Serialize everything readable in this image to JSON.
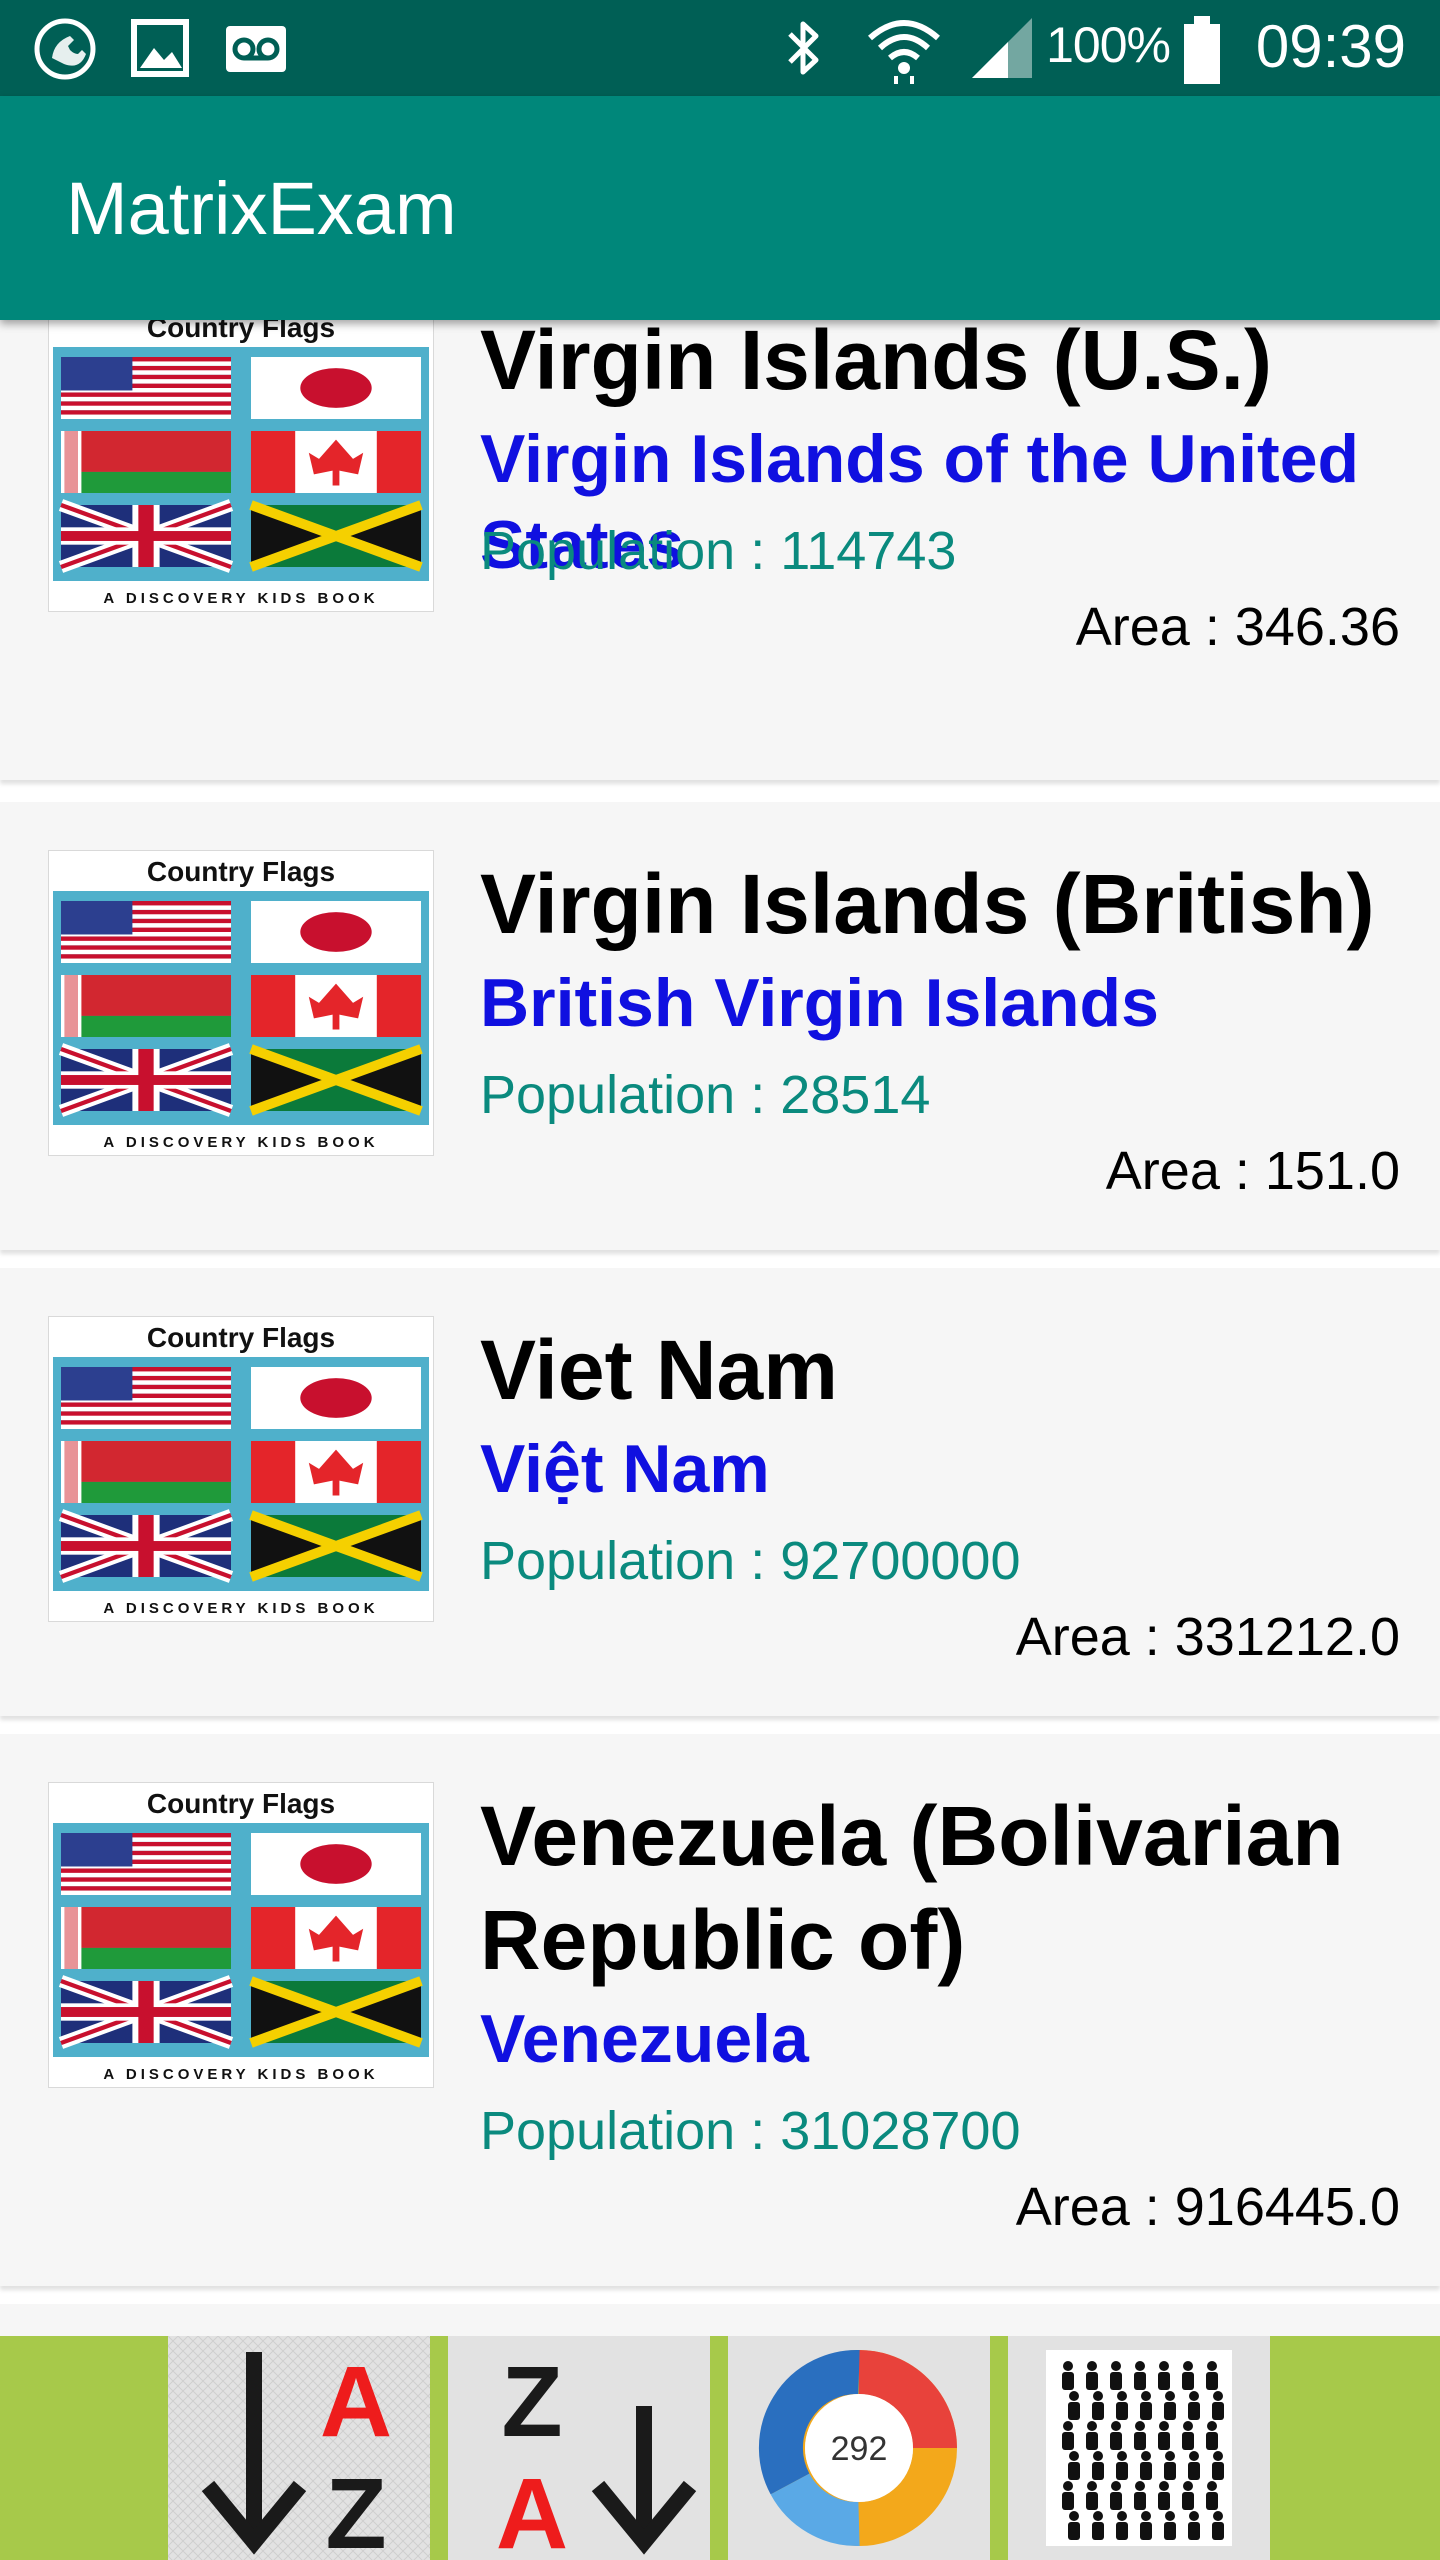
{
  "status_bar": {
    "battery_percent": "100%",
    "time": "09:39",
    "icons": [
      "call-missed-icon",
      "image-icon",
      "voicemail-icon",
      "bluetooth-icon",
      "wifi-icon",
      "signal-icon",
      "battery-icon"
    ]
  },
  "app_bar": {
    "title": "MatrixExam"
  },
  "thumbnail": {
    "title": "Country Flags",
    "caption": "A DISCOVERY KIDS BOOK"
  },
  "countries": [
    {
      "name": "Virgin Islands (U.S.)",
      "native_name": "Virgin Islands of the United States",
      "population": "Population : 114743",
      "area": "Area : 346.36"
    },
    {
      "name": "Virgin Islands (British)",
      "native_name": "British Virgin Islands",
      "population": "Population : 28514",
      "area": "Area : 151.0"
    },
    {
      "name": "Viet Nam",
      "native_name": "Việt Nam",
      "population": "Population : 92700000",
      "area": "Area : 331212.0"
    },
    {
      "name": "Venezuela (Bolivarian Republic of)",
      "native_name": "Venezuela",
      "population": "Population : 31028700",
      "area": "Area : 916445.0"
    }
  ],
  "bottom_bar": {
    "buttons": [
      {
        "icon": "sort-a-z-icon",
        "letters": [
          "A",
          "Z"
        ]
      },
      {
        "icon": "sort-z-a-icon",
        "letters": [
          "Z",
          "A"
        ]
      },
      {
        "icon": "altmetric-donut-icon",
        "badge": "292"
      },
      {
        "icon": "population-icon"
      }
    ]
  },
  "colors": {
    "status_bar": "#005f55",
    "app_bar": "#00877a",
    "native_name": "#1010e0",
    "population": "#0a8a7e",
    "bottom_bar": "#a7c94a"
  }
}
